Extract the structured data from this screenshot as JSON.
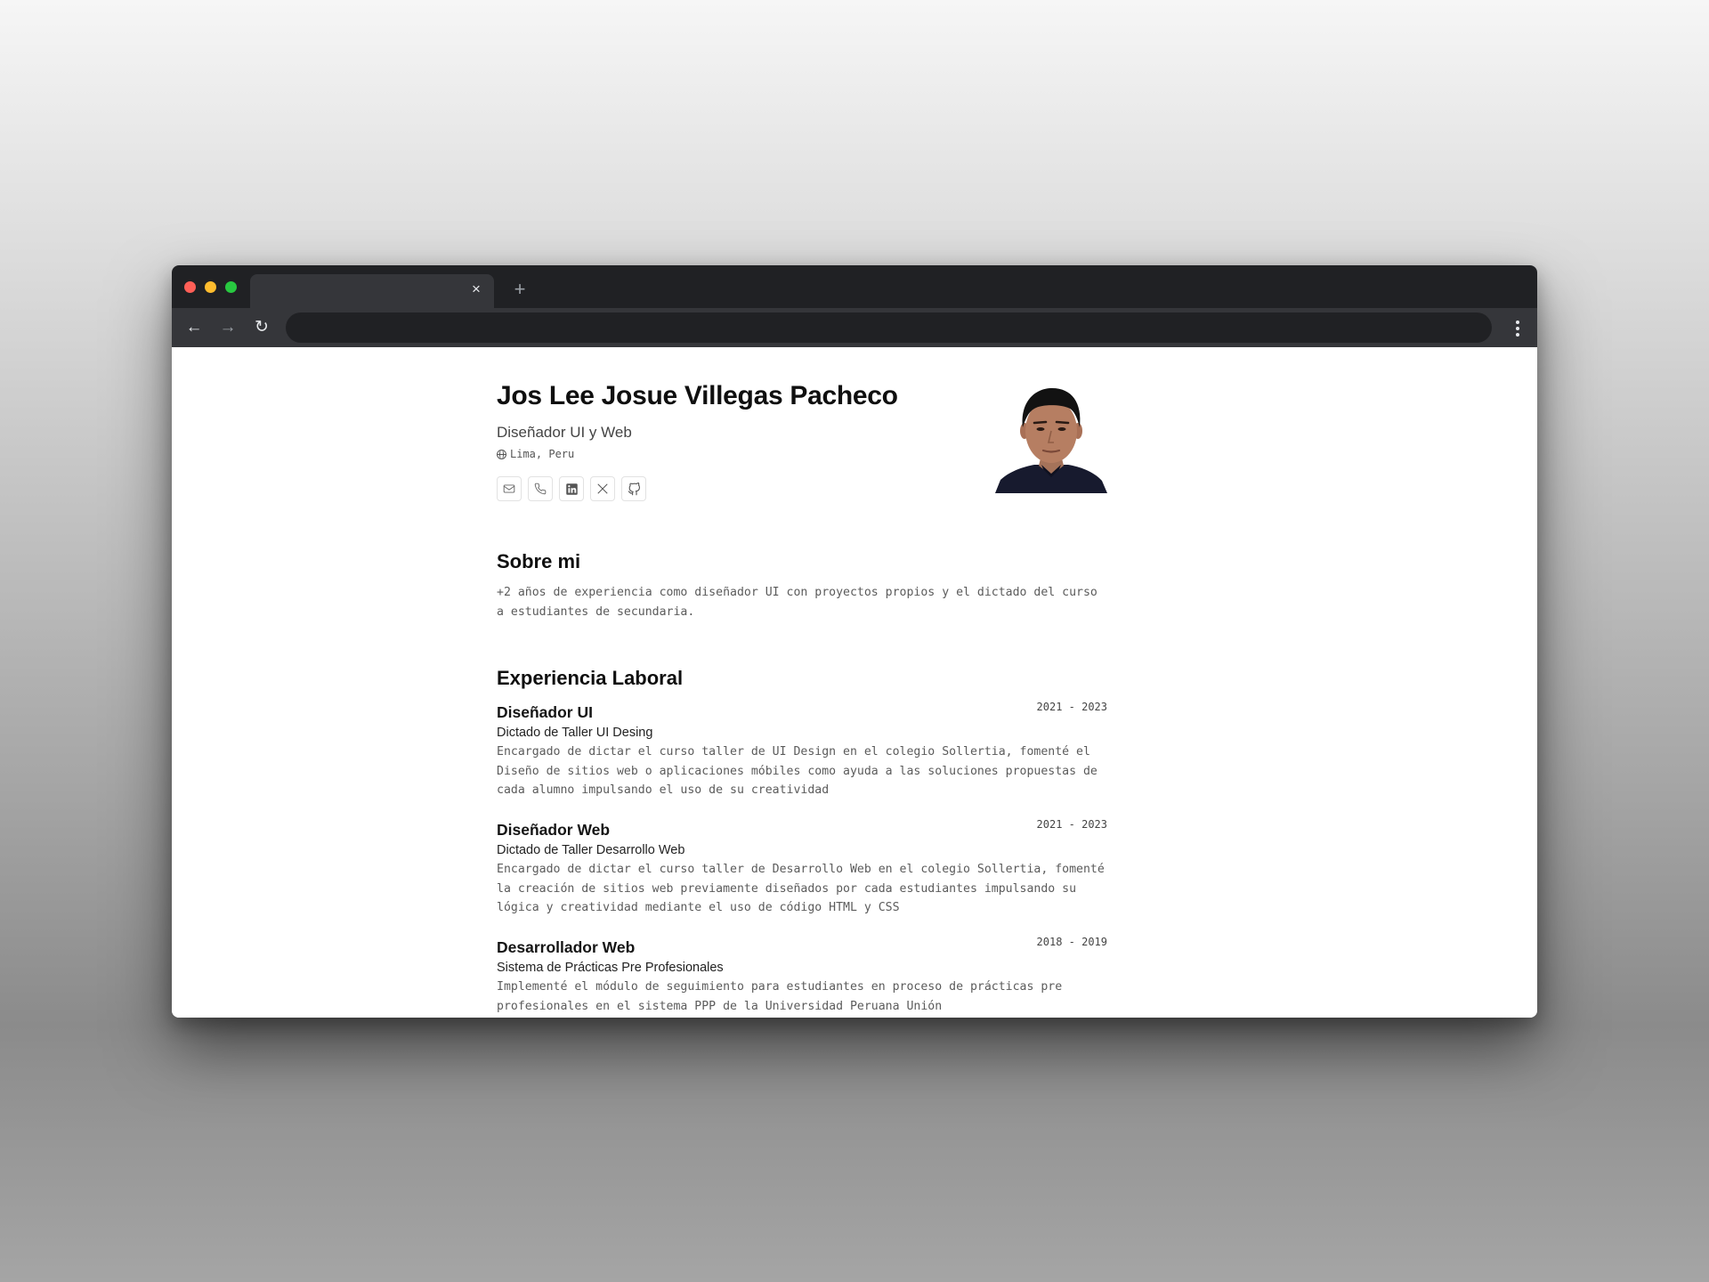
{
  "browser": {
    "tab_title": "",
    "tab_close": "×",
    "new_tab": "+",
    "back": "←",
    "forward": "→",
    "reload": "↻",
    "address": ""
  },
  "profile": {
    "name": "Jos Lee Josue Villegas Pacheco",
    "role": "Diseñador UI y Web",
    "location": "Lima, Peru",
    "contact_icons": [
      "mail-icon",
      "phone-icon",
      "linkedin-icon",
      "x-icon",
      "github-icon"
    ]
  },
  "about": {
    "title": "Sobre mi",
    "text": "+2 años de experiencia como diseñador UI con proyectos propios y el dictado del curso a estudiantes de secundaria."
  },
  "experience": {
    "title": "Experiencia Laboral",
    "jobs": [
      {
        "title": "Diseñador UI",
        "dates": "2021 - 2023",
        "company": "Dictado de Taller UI Desing",
        "description": "Encargado de dictar el curso taller de UI Design en el colegio Sollertia, fomenté el Diseño de sitios web o aplicaciones móbiles como ayuda a las soluciones propuestas de cada alumno impulsando el uso de su creatividad"
      },
      {
        "title": "Diseñador Web",
        "dates": "2021 - 2023",
        "company": "Dictado de Taller Desarrollo Web",
        "description": "Encargado de dictar el curso taller de Desarrollo Web en el colegio Sollertia, fomenté la creación de sitios web previamente diseñados por cada estudiantes impulsando su lógica y creatividad mediante el uso de código HTML y CSS"
      },
      {
        "title": "Desarrollador Web",
        "dates": "2018 - 2019",
        "company": "Sistema de Prácticas Pre Profesionales",
        "description": "Implementé el módulo de seguimiento para estudiantes en proceso de prácticas pre profesionales en el sistema PPP de la Universidad Peruana Unión"
      }
    ]
  },
  "colors": {
    "tabbar": "#202124",
    "toolbar": "#35363a",
    "close_dot": "#ff5f57",
    "minimize_dot": "#febc2e",
    "maximize_dot": "#28c840"
  }
}
